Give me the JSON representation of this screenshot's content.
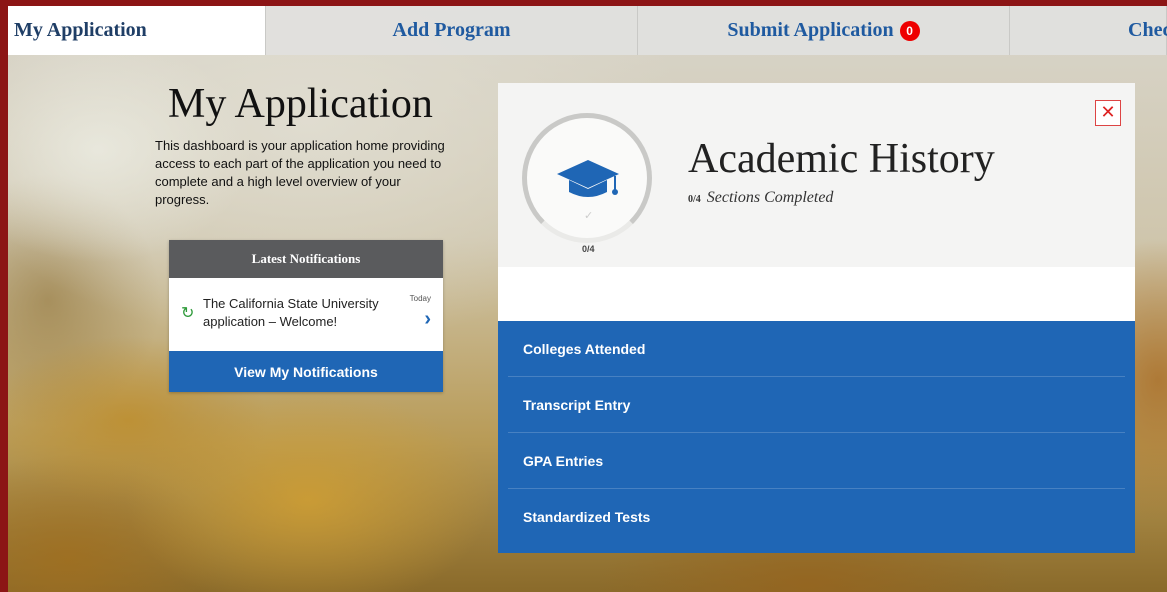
{
  "tabs": [
    {
      "label": "My Application"
    },
    {
      "label": "Add Program"
    },
    {
      "label": "Submit Application",
      "badge": "0"
    },
    {
      "label": "Chec"
    }
  ],
  "intro": {
    "title": "My Application",
    "description": "This dashboard is your application home providing access to each part of the application you need to complete and a high level overview of your progress."
  },
  "notifications": {
    "header": "Latest Notifications",
    "item": {
      "text": "The California State University application – Welcome!",
      "date": "Today",
      "icon": "refresh-icon"
    },
    "button": "View My Notifications"
  },
  "panel": {
    "title": "Academic History",
    "progress_fraction": "0/4",
    "progress_text": "Sections Completed",
    "ring_label": "0/4",
    "close_icon": "close-icon",
    "items": [
      {
        "label": "Colleges Attended"
      },
      {
        "label": "Transcript Entry"
      },
      {
        "label": "GPA Entries"
      },
      {
        "label": "Standardized Tests"
      }
    ]
  },
  "colors": {
    "accent": "#1f66b5",
    "frame": "#8c1515",
    "badge": "#e00000"
  }
}
